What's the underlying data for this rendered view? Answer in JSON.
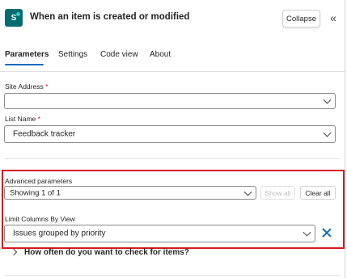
{
  "header": {
    "app_icon_text": "S",
    "title": "When an item is created or modified",
    "collapse_label": "Collapse",
    "collapse_icon": "double-chevron-left-icon"
  },
  "tabs": [
    {
      "label": "Parameters",
      "active": true
    },
    {
      "label": "Settings",
      "active": false
    },
    {
      "label": "Code view",
      "active": false
    },
    {
      "label": "About",
      "active": false
    }
  ],
  "fields": {
    "site_address": {
      "label": "Site Address",
      "required": "*",
      "value": ""
    },
    "list_name": {
      "label": "List Name",
      "required": "*",
      "value": "Feedback tracker"
    }
  },
  "advanced": {
    "label": "Advanced parameters",
    "value": "Showing 1 of 1",
    "show_all_label": "Show all",
    "clear_all_label": "Clear all"
  },
  "limit_columns": {
    "label": "Limit Columns By View",
    "value": "Issues grouped by priority",
    "remove_icon": "close-icon"
  },
  "expander": {
    "label": "How often do you want to check for items?"
  },
  "colors": {
    "accent": "#0f6cbd",
    "highlight": "#d7191c",
    "sharepoint": "#036c70"
  }
}
